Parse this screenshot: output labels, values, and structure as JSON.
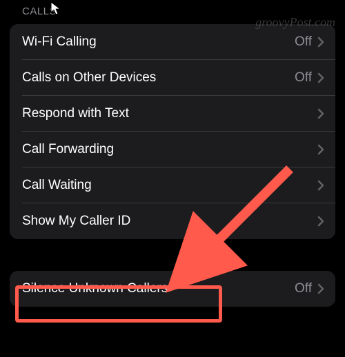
{
  "section_header": "CALLS",
  "watermark": "groovyPost.com",
  "calls_group": {
    "items": [
      {
        "label": "Wi-Fi Calling",
        "value": "Off"
      },
      {
        "label": "Calls on Other Devices",
        "value": "Off"
      },
      {
        "label": "Respond with Text",
        "value": ""
      },
      {
        "label": "Call Forwarding",
        "value": ""
      },
      {
        "label": "Call Waiting",
        "value": ""
      },
      {
        "label": "Show My Caller ID",
        "value": ""
      }
    ]
  },
  "silence_group": {
    "items": [
      {
        "label": "Silence Unknown Callers",
        "value": "Off"
      }
    ]
  },
  "annotation": {
    "highlight_color": "#ff5a4c",
    "target": "silence-unknown-callers-row"
  }
}
